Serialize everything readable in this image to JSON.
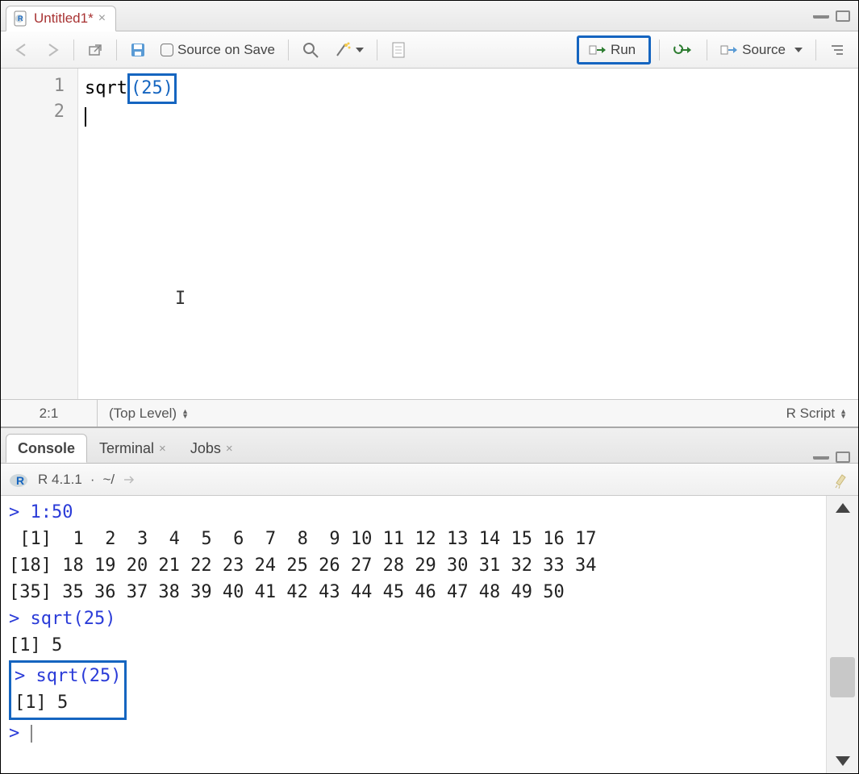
{
  "source": {
    "tab": {
      "title": "Untitled1*",
      "icon": "r-file-icon"
    },
    "toolbar": {
      "source_on_save": "Source on Save",
      "run": "Run",
      "source_label": "Source"
    },
    "code": {
      "lines": [
        "1",
        "2"
      ],
      "line1_fn": "sqrt",
      "line1_arg": "(25)"
    },
    "status": {
      "pos": "2:1",
      "scope": "(Top Level)",
      "type": "R Script"
    }
  },
  "console": {
    "tabs": {
      "console": "Console",
      "terminal": "Terminal",
      "jobs": "Jobs"
    },
    "header": {
      "version": "R 4.1.1",
      "path": "~/"
    },
    "output": {
      "l1": "> 1:50",
      "l2": " [1]  1  2  3  4  5  6  7  8  9 10 11 12 13 14 15 16 17",
      "l3": "[18] 18 19 20 21 22 23 24 25 26 27 28 29 30 31 32 33 34",
      "l4": "[35] 35 36 37 38 39 40 41 42 43 44 45 46 47 48 49 50",
      "l5": "> sqrt(25)",
      "l6": "[1] 5",
      "hl1": "> sqrt(25)",
      "hl2": "[1] 5",
      "prompt": "> "
    }
  }
}
